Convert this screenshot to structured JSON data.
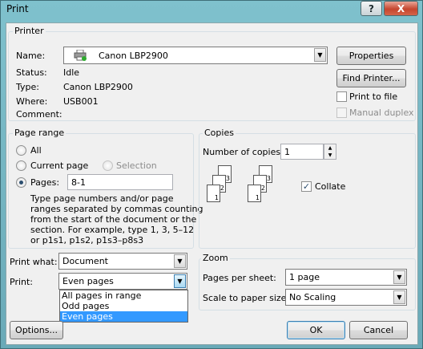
{
  "window": {
    "title": "Print",
    "help_label": "?",
    "close_label": "X"
  },
  "printer": {
    "group_label": "Printer",
    "name_label": "Name:",
    "name_value": "Canon LBP2900",
    "status_label": "Status:",
    "status_value": "Idle",
    "type_label": "Type:",
    "type_value": "Canon LBP2900",
    "where_label": "Where:",
    "where_value": "USB001",
    "comment_label": "Comment:",
    "comment_value": "",
    "properties_label": "Properties",
    "find_printer_label": "Find Printer...",
    "print_to_file_label": "Print to file",
    "print_to_file_checked": false,
    "manual_duplex_label": "Manual duplex",
    "manual_duplex_checked": false
  },
  "page_range": {
    "group_label": "Page range",
    "all_label": "All",
    "current_page_label": "Current page",
    "selection_label": "Selection",
    "pages_label": "Pages:",
    "pages_value": "8-1",
    "selected": "pages",
    "help_text_1": "Type page numbers and/or page",
    "help_text_2": "ranges separated by commas counting",
    "help_text_3": "from the start of the document or the",
    "help_text_4": "section. For example, type 1, 3, 5–12",
    "help_text_5": "or p1s1, p1s2, p1s3–p8s3"
  },
  "copies": {
    "group_label": "Copies",
    "number_label": "Number of copies:",
    "number_value": "1",
    "collate_label": "Collate",
    "collate_checked": true,
    "page_numbers": [
      "3",
      "2",
      "1"
    ]
  },
  "print_what": {
    "label": "Print what:",
    "value": "Document"
  },
  "print": {
    "label": "Print:",
    "value": "Even pages",
    "options": [
      "All pages in range",
      "Odd pages",
      "Even pages"
    ],
    "highlighted_option": "Even pages"
  },
  "zoom": {
    "group_label": "Zoom",
    "pages_per_sheet_label": "Pages per sheet:",
    "pages_per_sheet_value": "1 page",
    "scale_label": "Scale to paper size:",
    "scale_value": "No Scaling"
  },
  "buttons": {
    "options_label": "Options...",
    "ok_label": "OK",
    "cancel_label": "Cancel"
  },
  "icons": {
    "printer": "printer-icon",
    "dropdown": "chevron-down-icon",
    "spin_up": "spin-up-icon",
    "spin_down": "spin-down-icon",
    "check": "✓"
  }
}
